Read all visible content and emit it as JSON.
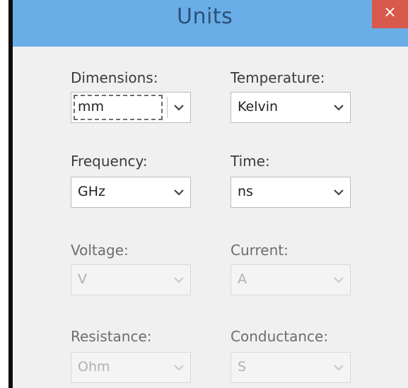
{
  "window": {
    "title": "Units",
    "close_glyph": "×"
  },
  "fields": {
    "dimensions": {
      "label": "Dimensions:",
      "value": "mm",
      "enabled": true,
      "focused": true
    },
    "temperature": {
      "label": "Temperature:",
      "value": "Kelvin",
      "enabled": true
    },
    "frequency": {
      "label": "Frequency:",
      "value": "GHz",
      "enabled": true
    },
    "time": {
      "label": "Time:",
      "value": "ns",
      "enabled": true
    },
    "voltage": {
      "label": "Voltage:",
      "value": "V",
      "enabled": false
    },
    "current": {
      "label": "Current:",
      "value": "A",
      "enabled": false
    },
    "resistance": {
      "label": "Resistance:",
      "value": "Ohm",
      "enabled": false
    },
    "conductance": {
      "label": "Conductance:",
      "value": "S",
      "enabled": false
    }
  },
  "colors": {
    "titlebar": "#6aaee8",
    "close_button": "#d75a4c",
    "window_background": "#f0f0f0"
  },
  "icons": {
    "dropdown": "chevron-down-icon",
    "close": "close-icon"
  }
}
